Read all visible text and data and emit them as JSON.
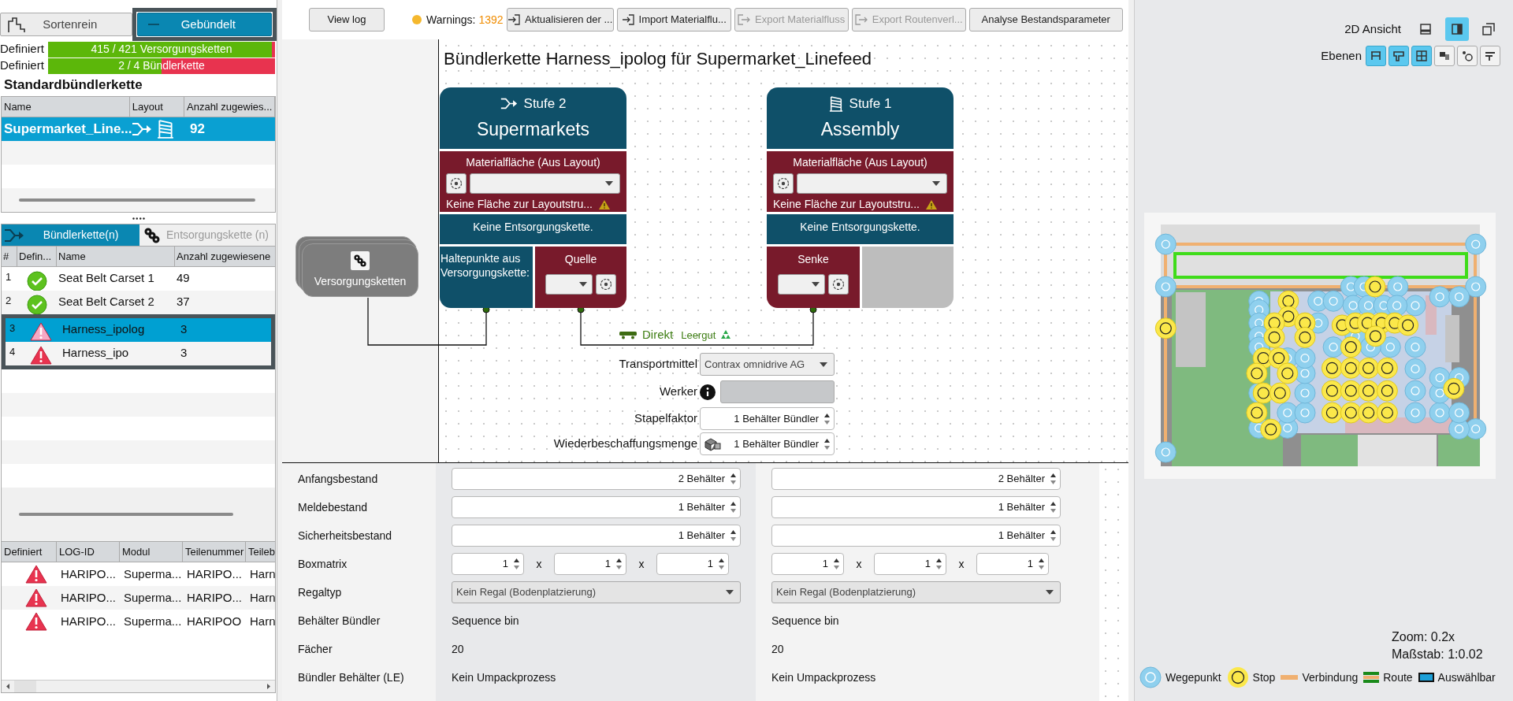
{
  "mode_toggle": [
    {
      "label": "Sortenrein",
      "selected": false,
      "highlighted": false
    },
    {
      "label": "Gebündelt",
      "selected": true,
      "highlighted": true
    }
  ],
  "progress": [
    {
      "label": "Definiert",
      "text": "415 / 421 Versorgungsketten",
      "level": 0.986
    },
    {
      "label": "Definiert",
      "text": "2 / 4 Bündlerkette",
      "level": 0.5
    }
  ],
  "standard_chain": {
    "title": "Standardbündlerkette",
    "columns": [
      "Name",
      "Layout",
      "Anzahl zugewies..."
    ],
    "rows": [
      {
        "name": "Supermarket_Line...",
        "count": "92",
        "selected": true
      }
    ]
  },
  "chain_tabs": [
    {
      "label": "Bündlerkette(n)",
      "selected": true
    },
    {
      "label": "Entsorgungskette (n)",
      "selected": false
    }
  ],
  "chain_table": {
    "columns": [
      "#",
      "Defin...",
      "Name",
      "Anzahl zugewiesene"
    ],
    "rows": [
      {
        "number": "1",
        "kind": "ok",
        "name": "Seat Belt Carset 1",
        "count": "49",
        "selected": false,
        "highlighted": false
      },
      {
        "number": "2",
        "kind": "ok",
        "name": "Seat Belt Carset 2",
        "count": "37",
        "selected": false,
        "highlighted": false
      },
      {
        "number": "3",
        "kind": "warning",
        "name": "Harness_ipolog",
        "count": "3",
        "selected": true,
        "highlighted": true
      },
      {
        "number": "4",
        "kind": "warning",
        "name": "Harness_ipo",
        "count": "3",
        "selected": false,
        "highlighted": true
      }
    ]
  },
  "parts_table": {
    "status_header": "Definiert",
    "columns": [
      "LOG-ID",
      "Modul",
      "Teilenummer",
      "Teileb"
    ],
    "rows": [
      {
        "kind": "warning",
        "cells": [
          "HARIPO...",
          "Superma...",
          "HARIPO...",
          "Harn"
        ]
      },
      {
        "kind": "warning",
        "cells": [
          "HARIPO...",
          "Superma...",
          "HARIPO...",
          "Harn"
        ]
      },
      {
        "kind": "warning",
        "cells": [
          "HARIPO...",
          "Superma...",
          "HARIPOO",
          "Harn"
        ]
      }
    ]
  },
  "toolbar": {
    "view_log": "View log",
    "warnings_label": "Warnings:",
    "warnings_count": "1392",
    "actions": [
      {
        "label": "Aktualisieren der ...",
        "disabled": false
      },
      {
        "label": "Import Materialflu...",
        "disabled": false
      },
      {
        "label": "Export Materialfluss",
        "disabled": true
      },
      {
        "label": "Export Routenverl...",
        "disabled": true
      },
      {
        "label": "Analyse Bestandsparameter",
        "disabled": false
      }
    ]
  },
  "diagram": {
    "title": "Bündlerkette Harness_ipolog für Supermarket_Linefeed",
    "source": "Versorgungsketten",
    "stages": [
      {
        "stage": "Stufe 2",
        "name": "Supermarkets",
        "material_label": "Materialfläche (Aus Layout)",
        "warning": "Keine Fläche zur Layoutstru...",
        "disposal": "Keine Entsorgungskette.",
        "halt_label": "Haltepunkte aus Versorgungskette:",
        "endpoint": "Quelle"
      },
      {
        "stage": "Stufe 1",
        "name": "Assembly",
        "material_label": "Materialfläche (Aus Layout)",
        "warning": "Keine Fläche zur Layoutstru...",
        "disposal": "Keine Entsorgungskette.",
        "endpoint": "Senke"
      }
    ],
    "link": {
      "transport": "Direkt",
      "empties": "Leergut"
    },
    "form": [
      {
        "label": "Transportmittel",
        "kind": "select",
        "value": "Contrax omnidrive AG"
      },
      {
        "label": "Werker",
        "kind": "info-select"
      },
      {
        "label": "Stapelfaktor",
        "kind": "spin",
        "value": "1 Behälter Bündler"
      },
      {
        "label": "Wiederbeschaffungsmenge",
        "kind": "spin-icon",
        "value": "1 Behälter Bündler"
      }
    ]
  },
  "parameters": [
    {
      "label": "Anfangsbestand",
      "kind": "spin",
      "values": [
        "2 Behälter",
        "2 Behälter"
      ]
    },
    {
      "label": "Meldebestand",
      "kind": "spin",
      "values": [
        "1 Behälter",
        "1 Behälter"
      ]
    },
    {
      "label": "Sicherheitsbestand",
      "kind": "spin",
      "values": [
        "1 Behälter",
        "1 Behälter"
      ]
    },
    {
      "label": "Boxmatrix",
      "kind": "matrix",
      "values": [
        {
          "cells": [
            "1",
            "1",
            "1"
          ],
          "separators": [
            "x",
            "x"
          ]
        },
        {
          "cells": [
            "1",
            "1",
            "1"
          ],
          "separators": [
            "x",
            "x"
          ]
        }
      ]
    },
    {
      "label": "Regaltyp",
      "kind": "select",
      "values": [
        "Kein Regal (Bodenplatzierung)",
        "Kein Regal (Bodenplatzierung)"
      ]
    },
    {
      "label": "Behälter Bündler",
      "kind": "text",
      "values": [
        "Sequence bin",
        "Sequence bin"
      ]
    },
    {
      "label": "Fächer",
      "kind": "text",
      "values": [
        "20",
        "20"
      ]
    },
    {
      "label": "Bündler Behälter (LE)",
      "kind": "text",
      "values": [
        "Kein Umpackprozess",
        "Kein Umpackprozess"
      ]
    }
  ],
  "view2d": {
    "title": "2D Ansicht",
    "view_buttons": [
      {
        "selected": false
      },
      {
        "selected": true
      },
      {
        "selected": false
      }
    ],
    "layers_label": "Ebenen",
    "layers": [
      {
        "on": true
      },
      {
        "on": true
      },
      {
        "on": true
      },
      {
        "on": false
      },
      {
        "on": false
      },
      {
        "on": false
      }
    ],
    "zoom": "Zoom: 0.2x",
    "scale": "Maßstab: 1:0.02",
    "legend": [
      {
        "label": "Wegepunkt",
        "kind": "waypoint"
      },
      {
        "label": "Stop",
        "kind": "stop"
      },
      {
        "label": "Verbindung",
        "kind": "connection"
      },
      {
        "label": "Route",
        "kind": "route"
      },
      {
        "label": "Auswählbar",
        "kind": "selectable"
      }
    ]
  }
}
